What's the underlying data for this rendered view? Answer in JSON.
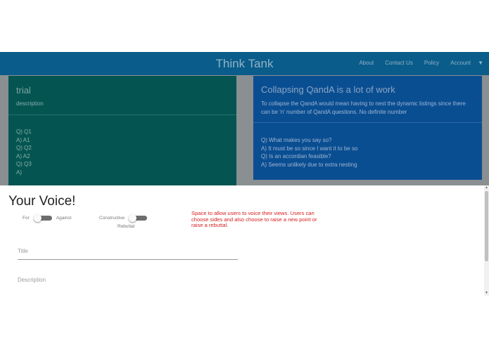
{
  "header": {
    "brand": "Think Tank",
    "links": [
      "About",
      "Contact Us",
      "Policy",
      "Account"
    ],
    "caret": "▼"
  },
  "cards": [
    {
      "title": "trial",
      "description": "description",
      "qa": [
        "Q) Q1",
        "A) A1",
        "Q) Q2",
        "A) A2",
        "Q) Q3",
        "A)"
      ]
    },
    {
      "title": "Collapsing QandA is a lot of work",
      "description": "To collapse the QandA would mean having to nest the dynamic listings since there can be 'n' number of QandA questions. No definite number",
      "qa": [
        "Q) What makes you say so?",
        "A) It must be so since I want it to be so",
        "Q) Is an accordian feasible?",
        "A) Seems unlikely due to extra nesting"
      ]
    }
  ],
  "voice": {
    "title": "Your Voice!",
    "toggle1": {
      "left": "For",
      "right": "Against"
    },
    "toggle2": {
      "left": "Constructive",
      "below": "Rebuttal"
    },
    "note": "Space to allow users to voice their views. Users can choose sides and also choose to raise a new point or raise a rebuttal.",
    "fields": {
      "title": "Title",
      "description": "Description"
    }
  },
  "scrollbar": {
    "up": "▲",
    "down": "▼"
  }
}
